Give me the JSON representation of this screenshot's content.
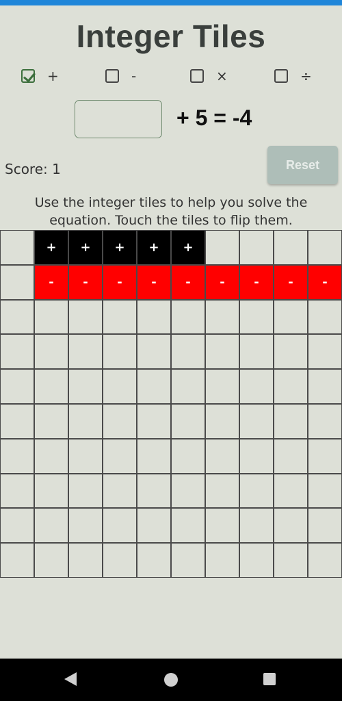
{
  "app": {
    "title": "Integer Tiles"
  },
  "operations": [
    {
      "symbol": "+",
      "checked": true
    },
    {
      "symbol": "-",
      "checked": false
    },
    {
      "symbol": "×",
      "checked": false
    },
    {
      "symbol": "÷",
      "checked": false
    }
  ],
  "equation": {
    "answer_value": "",
    "text": "+ 5 = -4"
  },
  "score": {
    "label": "Score: 1"
  },
  "reset": {
    "label": "Reset"
  },
  "instructions": {
    "text": "Use the integer tiles to help you solve the equation. Touch the tiles to flip them."
  },
  "tiles": {
    "positive_symbol": "+",
    "negative_symbol": "-",
    "positive_count": 5,
    "negative_count": 9,
    "grid_columns": 10,
    "grid_rows": 10
  },
  "colors": {
    "positive_tile": "#000000",
    "negative_tile": "#ff0000",
    "reset_button": "#aebeb8",
    "check": "#3b6e3b"
  },
  "nav": {
    "icons": [
      "back-icon",
      "home-icon",
      "recent-apps-icon"
    ]
  }
}
